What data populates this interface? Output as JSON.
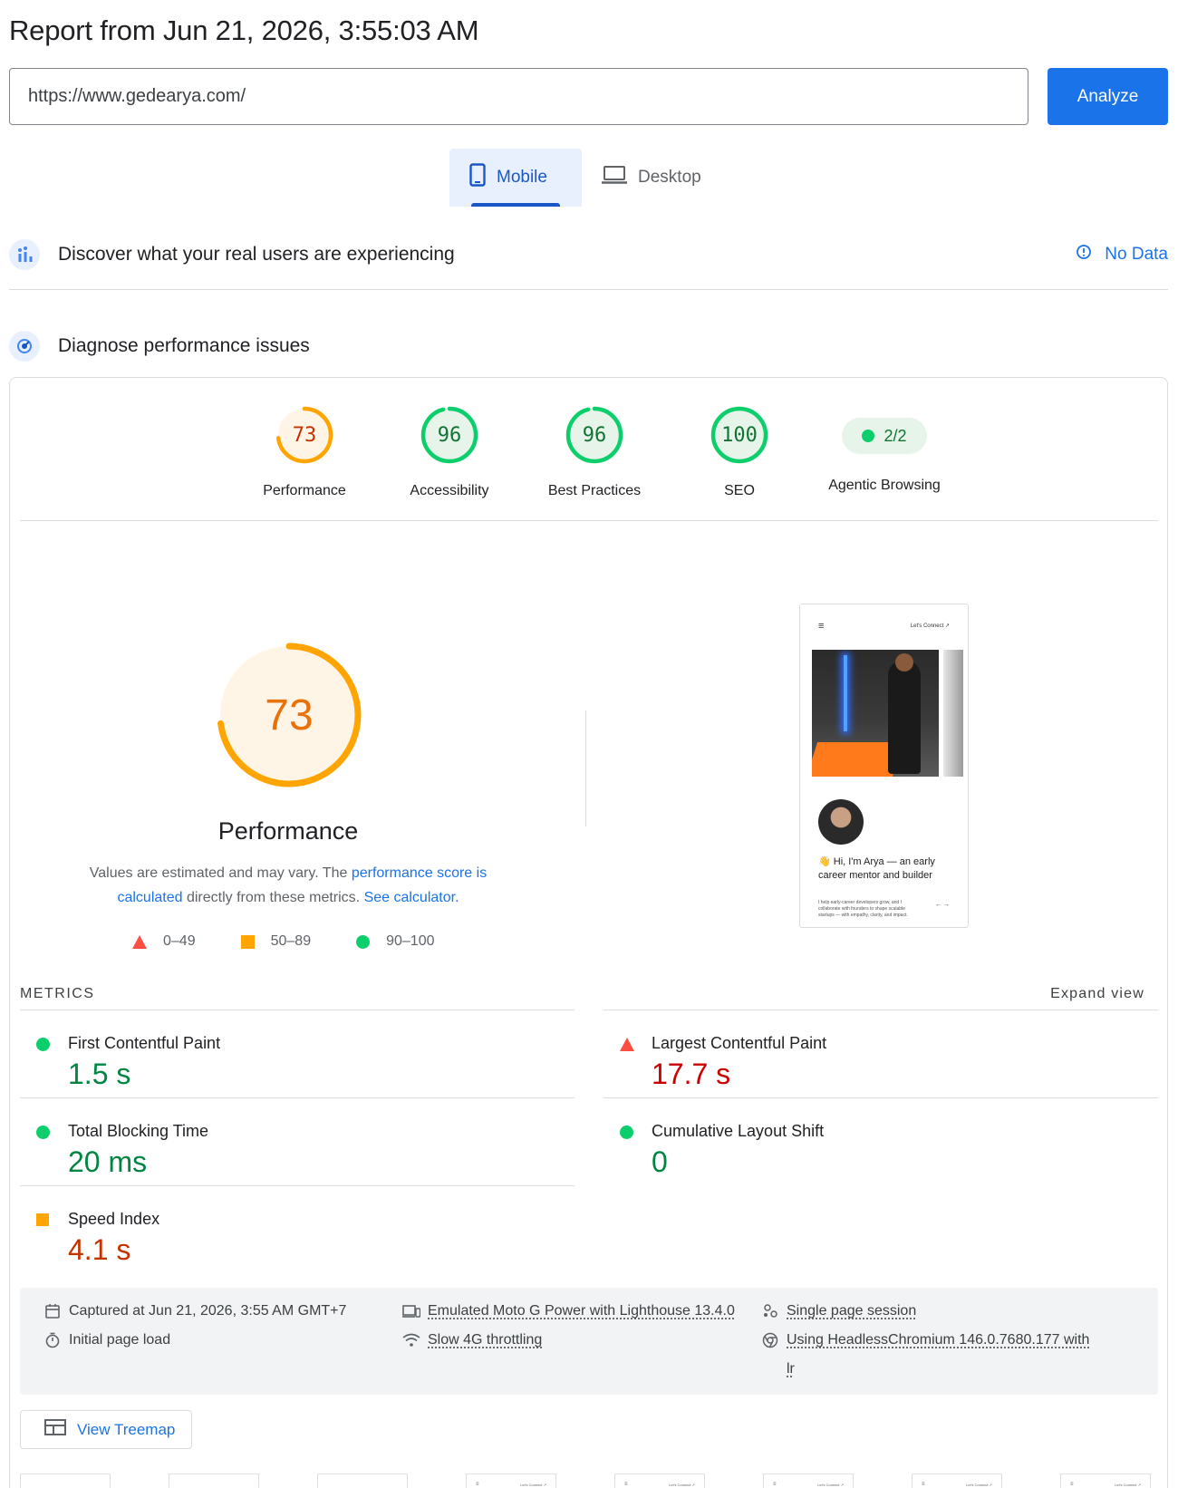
{
  "report": {
    "title": "Report from Jun 21, 2026, 3:55:03 AM"
  },
  "search": {
    "url": "https://www.gedearya.com/",
    "analyze_label": "Analyze"
  },
  "tabs": {
    "mobile": "Mobile",
    "desktop": "Desktop"
  },
  "field_data": {
    "title": "Discover what your real users are experiencing",
    "status": "No Data"
  },
  "diagnose": {
    "title": "Diagnose performance issues"
  },
  "scores": [
    {
      "label": "Performance",
      "value": "73",
      "fraction": 0.73,
      "rating": "average"
    },
    {
      "label": "Accessibility",
      "value": "96",
      "fraction": 0.96,
      "rating": "good"
    },
    {
      "label": "Best Practices",
      "value": "96",
      "fraction": 0.96,
      "rating": "good"
    },
    {
      "label": "SEO",
      "value": "100",
      "fraction": 1.0,
      "rating": "good"
    }
  ],
  "agentic": {
    "label": "Agentic Browsing",
    "value": "2/2"
  },
  "performance": {
    "score": "73",
    "fraction": 0.73,
    "title": "Performance",
    "note_prefix": "Values are estimated and may vary. The ",
    "note_link1": "performance score is calculated",
    "note_middle": " directly from these metrics. ",
    "note_link2": "See calculator.",
    "legend": {
      "poor": "0–49",
      "average": "50–89",
      "good": "90–100"
    }
  },
  "screenshot": {
    "menu_icon": "≡",
    "connect": "Let's Connect ↗",
    "headline": "👋 Hi, I'm Arya — an early career mentor and builder",
    "sub": "I help early-career developers grow, and I collaborate with founders to shape scalable startups — with empathy, clarity, and impact.",
    "arrows": "←  →"
  },
  "metrics": {
    "label": "METRICS",
    "expand": "Expand view",
    "items": [
      {
        "name": "First Contentful Paint",
        "value": "1.5 s",
        "rating": "good"
      },
      {
        "name": "Largest Contentful Paint",
        "value": "17.7 s",
        "rating": "poor"
      },
      {
        "name": "Total Blocking Time",
        "value": "20 ms",
        "rating": "good"
      },
      {
        "name": "Cumulative Layout Shift",
        "value": "0",
        "rating": "good"
      },
      {
        "name": "Speed Index",
        "value": "4.1 s",
        "rating": "average"
      }
    ]
  },
  "info": {
    "captured": "Captured at Jun 21, 2026, 3:55 AM GMT+7",
    "initial_load": "Initial page load",
    "emulated": "Emulated Moto G Power with Lighthouse 13.4.0",
    "throttling": "Slow 4G throttling",
    "session": "Single page session",
    "browser_line1": "Using HeadlessChromium 146.0.7680.177 with",
    "browser_line2": "lr"
  },
  "treemap": {
    "label": "View Treemap"
  },
  "filmstrip": {
    "menu": "≡",
    "connect": "Let's Connect ↗"
  },
  "colors": {
    "good": "#0cce6b",
    "average": "#ffa400",
    "poor": "#ff4e42",
    "accent": "#1a73e8"
  }
}
